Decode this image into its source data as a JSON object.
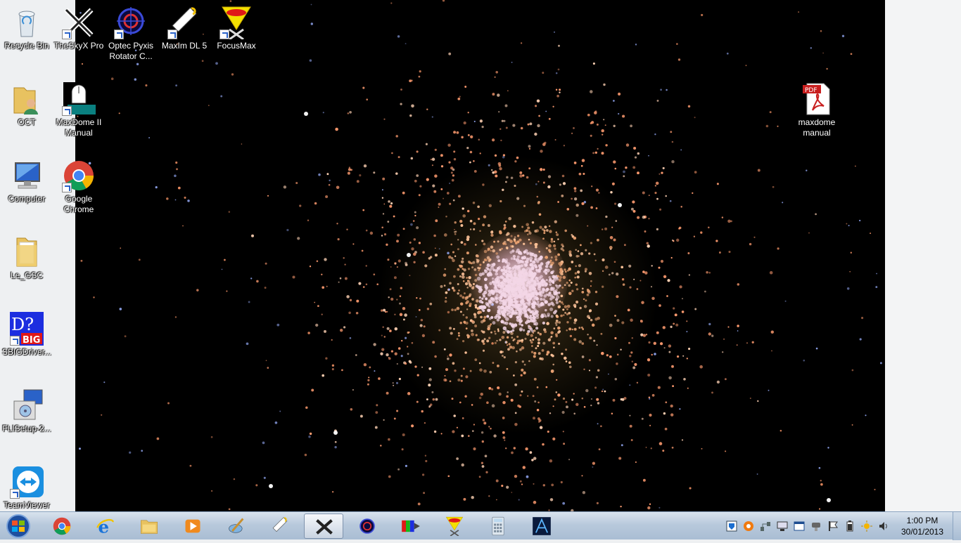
{
  "desktop": {
    "icons": [
      {
        "id": "recycle-bin",
        "label": "Recycle Bin"
      },
      {
        "id": "theskyx-pro",
        "label": "TheSkyX Pro"
      },
      {
        "id": "optec-pyxis",
        "label": "Optec Pyxis Rotator C..."
      },
      {
        "id": "maxim-dl5",
        "label": "MaxIm DL 5"
      },
      {
        "id": "focusmax",
        "label": "FocusMax"
      },
      {
        "id": "oct-folder",
        "label": "OCT"
      },
      {
        "id": "maxdome-manual-shortcut",
        "label": "MaxDome II Manual"
      },
      {
        "id": "computer",
        "label": "Computer"
      },
      {
        "id": "google-chrome",
        "label": "Google Chrome"
      },
      {
        "id": "le-gsc",
        "label": "Le_GSC"
      },
      {
        "id": "sbigdriver",
        "label": "SBIGDriver..."
      },
      {
        "id": "flisetup",
        "label": "FLISetup-2..."
      },
      {
        "id": "teamviewer",
        "label": "TeamViewer"
      },
      {
        "id": "maxdome-manual-pdf",
        "label": "maxdome manual"
      }
    ],
    "pdf_badge": "PDF",
    "sbig_letters": {
      "top": "D?",
      "bottom": "BIG"
    }
  },
  "taskbar": {
    "start": "start-orb-icon",
    "pinned": [
      "chrome-icon",
      "ie-icon",
      "explorer-icon",
      "media-player-icon",
      "paint-brush-icon",
      "maxim-icon",
      "theskyx-icon",
      "pyxis-icon",
      "rgb-arrow-icon",
      "focusmax-icon",
      "calculator-icon",
      "star-chart-icon"
    ],
    "active_index": 6
  },
  "tray": {
    "icons": [
      "shield-icon",
      "orange-circle-icon",
      "network-icon",
      "display-icon",
      "window-icon",
      "usb-icon",
      "flag-icon",
      "battery-icon",
      "brightness-icon",
      "speaker-icon"
    ]
  },
  "clock": {
    "time": "1:00 PM",
    "date": "30/01/2013"
  },
  "colors": {
    "wallpaper": "#000000",
    "star": "#ffb08a",
    "taskbar": "#b8c9dc"
  }
}
